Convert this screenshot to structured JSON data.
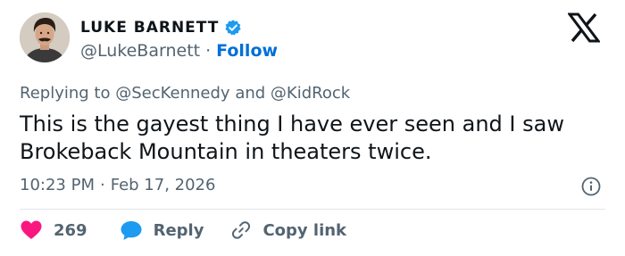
{
  "author": {
    "display_name": "LUKE BARNETT",
    "handle": "@LukeBarnett",
    "separator": "·",
    "follow_label": "Follow",
    "verified": true
  },
  "reply_context": {
    "prefix": "Replying to",
    "mention_1": "@SecKennedy",
    "conjunction": "and",
    "mention_2": "@KidRock"
  },
  "tweet": {
    "text": "This is the gayest thing I have ever seen and I saw Brokeback Mountain in theaters twice."
  },
  "meta": {
    "time": "10:23 PM",
    "separator": "·",
    "date": "Feb 17, 2026"
  },
  "actions": {
    "like_count": "269",
    "reply_label": "Reply",
    "copy_label": "Copy link"
  },
  "colors": {
    "link_blue": "#006fd6",
    "verified_blue": "#1d9bf0",
    "heart_red": "#f91880",
    "muted": "#536471",
    "text": "#0f1419"
  },
  "icons": [
    "verified-badge-icon",
    "x-logo-icon",
    "info-icon",
    "heart-icon",
    "reply-bubble-icon",
    "link-icon"
  ]
}
